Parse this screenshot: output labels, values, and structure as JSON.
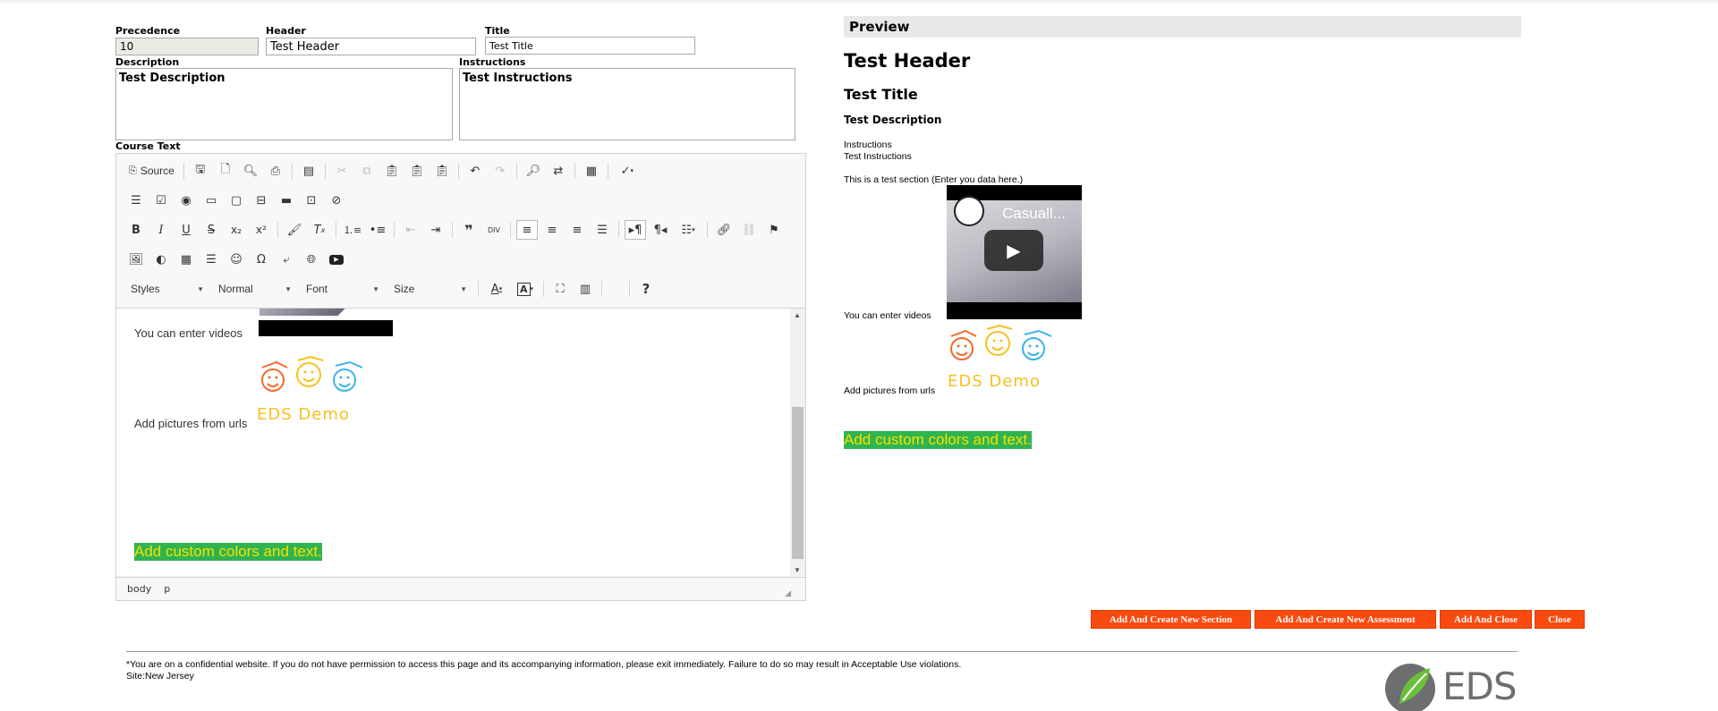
{
  "form": {
    "precedence_label": "Precedence",
    "precedence_value": "10",
    "header_label": "Header",
    "header_value": "Test Header",
    "title_label": "Title",
    "title_value": "Test Title",
    "description_label": "Description",
    "description_value": "Test Description",
    "instructions_label": "Instructions",
    "instructions_value": "Test Instructions",
    "course_text_label": "Course Text"
  },
  "editor": {
    "source_label": "Source",
    "styles_label": "Styles",
    "format_label": "Normal",
    "font_label": "Font",
    "size_label": "Size",
    "help_label": "?",
    "content": {
      "videos_text": "You can enter videos",
      "pictures_text": "Add pictures from urls",
      "logo_text": "EDS Demo",
      "custom_text": "Add custom colors and text."
    },
    "path": [
      "body",
      "p"
    ]
  },
  "preview": {
    "title": "Preview",
    "header": "Test Header",
    "title_text": "Test Title",
    "description": "Test Description",
    "instructions_label": "Instructions",
    "instructions_value": "Test Instructions",
    "section_text": "This is a test section (Enter you data here.)",
    "video_title": "Casuall...",
    "videos_text": "You can enter videos",
    "pictures_text": "Add pictures from urls",
    "logo_text": "EDS Demo",
    "custom_text": "Add custom colors and text."
  },
  "buttons": {
    "add_section": "Add And Create New Section",
    "add_assessment": "Add And Create New Assessment",
    "add_close": "Add And Close",
    "close": "Close"
  },
  "footer": {
    "notice": "*You are on a confidential website. If you do not have permission to access this page and its accompanying information, please exit immediately. Failure to do so may result in Acceptable Use violations.",
    "site": "Site:New Jersey",
    "logo_text": "EDS"
  },
  "colors": {
    "accent_button": "#fa4a10",
    "custom_text_bg": "#2fb450",
    "custom_text_fg": "#f7e000",
    "logo_green": "#6cbf3b",
    "logo_gray": "#6d6e70"
  }
}
